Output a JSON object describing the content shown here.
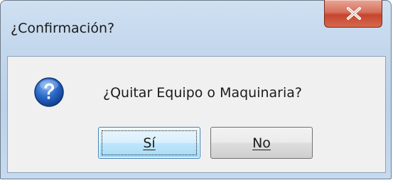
{
  "window": {
    "title": "¿Confirmación?"
  },
  "dialog": {
    "message": "¿Quitar Equipo o Maquinaria?",
    "icon": "question-icon"
  },
  "buttons": {
    "yes_label": "Sí",
    "no_label": "No",
    "close_icon": "close-icon"
  },
  "colors": {
    "close_button": "#c7452e",
    "question_icon": "#1f5fc4",
    "default_button_border": "#3c7fb1"
  }
}
